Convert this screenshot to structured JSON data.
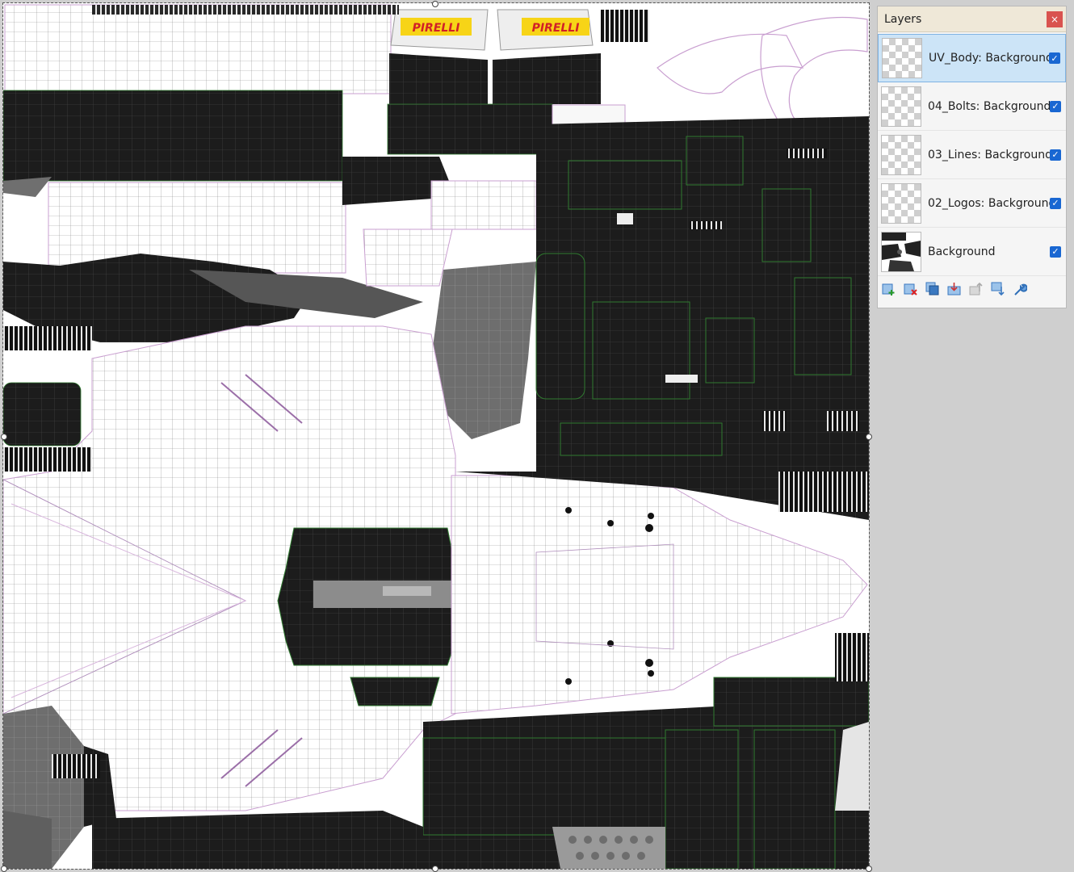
{
  "layers_panel": {
    "title": "Layers",
    "close_label": "×",
    "layers": [
      {
        "name": "UV_Body: Background",
        "visible": true,
        "selected": true
      },
      {
        "name": "04_Bolts: Background",
        "visible": true,
        "selected": false
      },
      {
        "name": "03_Lines: Background",
        "visible": true,
        "selected": false
      },
      {
        "name": "02_Logos: Background",
        "visible": true,
        "selected": false
      },
      {
        "name": "Background",
        "visible": true,
        "selected": false
      }
    ],
    "toolbar": [
      {
        "name": "add-layer-icon"
      },
      {
        "name": "delete-layer-icon"
      },
      {
        "name": "duplicate-layer-icon"
      },
      {
        "name": "merge-layer-down-icon"
      },
      {
        "name": "move-layer-up-icon"
      },
      {
        "name": "move-layer-down-icon"
      },
      {
        "name": "layer-properties-icon"
      }
    ]
  },
  "canvas": {
    "logo_text": "PIRELLI",
    "logo_color": "#f7d417",
    "logo_text_color": "#d22027"
  },
  "colors": {
    "accent": "#1967d2",
    "panel_header": "#efe8d8",
    "close": "#d9534f",
    "selection": "#cce4f7"
  }
}
